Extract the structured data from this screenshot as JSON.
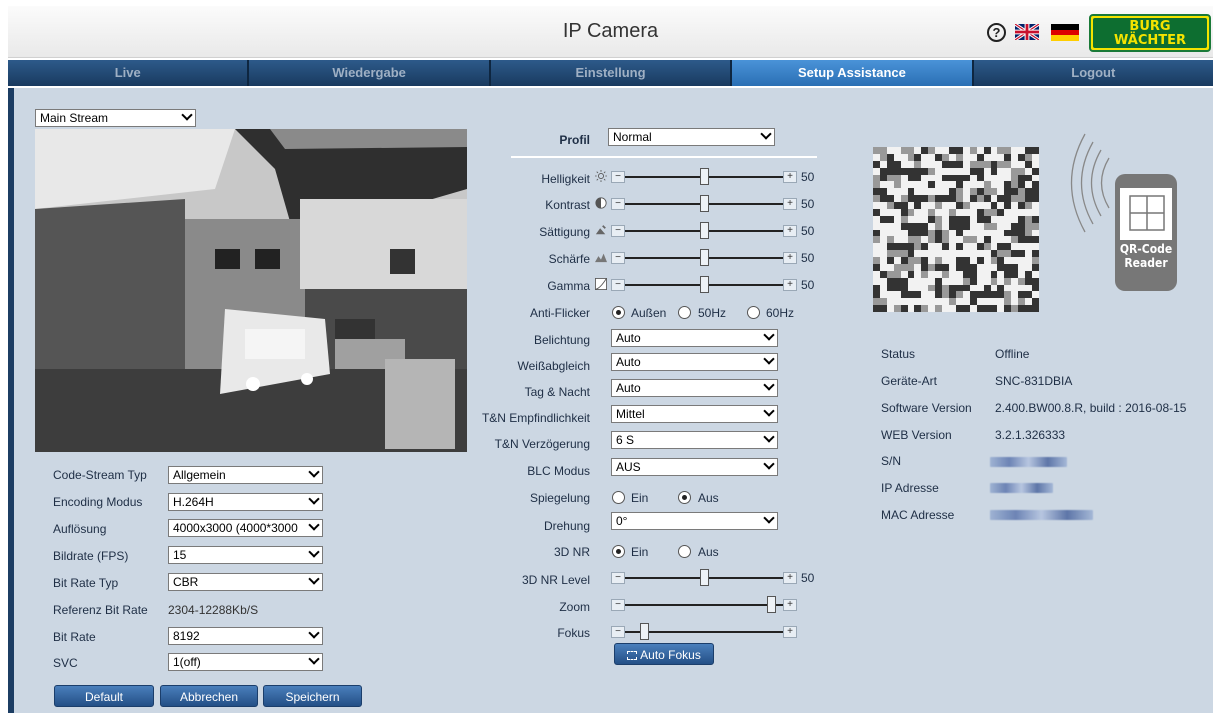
{
  "header": {
    "title": "IP Camera",
    "help_icon": "?",
    "logo_line1": "BURG",
    "logo_line2": "WÄCHTER"
  },
  "nav": {
    "tabs": [
      "Live",
      "Wiedergabe",
      "Einstellung",
      "Setup Assistance",
      "Logout"
    ],
    "active": "Setup Assistance"
  },
  "stream": {
    "selected": "Main Stream"
  },
  "encoding": {
    "code_stream_typ": {
      "label": "Code-Stream Typ",
      "value": "Allgemein"
    },
    "encoding_modus": {
      "label": "Encoding Modus",
      "value": "H.264H"
    },
    "aufloesung": {
      "label": "Auflösung",
      "value": "4000x3000 (4000*3000"
    },
    "bildrate": {
      "label": "Bildrate (FPS)",
      "value": "15"
    },
    "bit_rate_typ": {
      "label": "Bit Rate Typ",
      "value": "CBR"
    },
    "referenz_bit_rate": {
      "label": "Referenz Bit Rate",
      "value": "2304-12288Kb/S"
    },
    "bit_rate": {
      "label": "Bit Rate",
      "value": "8192"
    },
    "svc": {
      "label": "SVC",
      "value": "1(off)"
    }
  },
  "buttons": {
    "default": "Default",
    "abbrechen": "Abbrechen",
    "speichern": "Speichern",
    "auto_fokus": "Auto Fokus"
  },
  "image": {
    "profil": {
      "label": "Profil",
      "value": "Normal"
    },
    "helligkeit": {
      "label": "Helligkeit",
      "value": "50",
      "level": 0.5
    },
    "kontrast": {
      "label": "Kontrast",
      "value": "50",
      "level": 0.5
    },
    "saettigung": {
      "label": "Sättigung",
      "value": "50",
      "level": 0.5
    },
    "schaerfe": {
      "label": "Schärfe",
      "value": "50",
      "level": 0.5
    },
    "gamma": {
      "label": "Gamma",
      "value": "50",
      "level": 0.5
    },
    "anti_flicker": {
      "label": "Anti-Flicker",
      "options": [
        "Außen",
        "50Hz",
        "60Hz"
      ],
      "selected": "Außen"
    },
    "belichtung": {
      "label": "Belichtung",
      "value": "Auto"
    },
    "weissabgleich": {
      "label": "Weißabgleich",
      "value": "Auto"
    },
    "tag_nacht": {
      "label": "Tag & Nacht",
      "value": "Auto"
    },
    "tn_empfindlichkeit": {
      "label": "T&N Empfindlichkeit",
      "value": "Mittel"
    },
    "tn_verzoegerung": {
      "label": "T&N Verzögerung",
      "value": "6 S"
    },
    "blc_modus": {
      "label": "BLC Modus",
      "value": "AUS"
    },
    "spiegelung": {
      "label": "Spiegelung",
      "options": [
        "Ein",
        "Aus"
      ],
      "selected": "Aus"
    },
    "drehung": {
      "label": "Drehung",
      "value": "0°"
    },
    "nr3d": {
      "label": "3D NR",
      "options": [
        "Ein",
        "Aus"
      ],
      "selected": "Ein"
    },
    "nr3d_level": {
      "label": "3D NR Level",
      "value": "50",
      "level": 0.5
    },
    "zoom": {
      "label": "Zoom",
      "level": 0.95
    },
    "fokus": {
      "label": "Fokus",
      "level": 0.1
    }
  },
  "qr": {
    "reader_line1": "QR-Code",
    "reader_line2": "Reader"
  },
  "device": {
    "status": {
      "label": "Status",
      "value": "Offline"
    },
    "geraete_art": {
      "label": "Geräte-Art",
      "value": "SNC-831DBIA"
    },
    "software_version": {
      "label": "Software Version",
      "value": "2.400.BW00.8.R, build : 2016-08-15"
    },
    "web_version": {
      "label": "WEB Version",
      "value": "3.2.1.326333"
    },
    "sn": {
      "label": "S/N"
    },
    "ip_adresse": {
      "label": "IP Adresse"
    },
    "mac_adresse": {
      "label": "MAC Adresse"
    }
  },
  "colors": {
    "nav_active": "#3a84cc",
    "nav_bg": "#1c3d63",
    "panel_bg": "#ccd7e3",
    "button": "#2f5f99"
  }
}
